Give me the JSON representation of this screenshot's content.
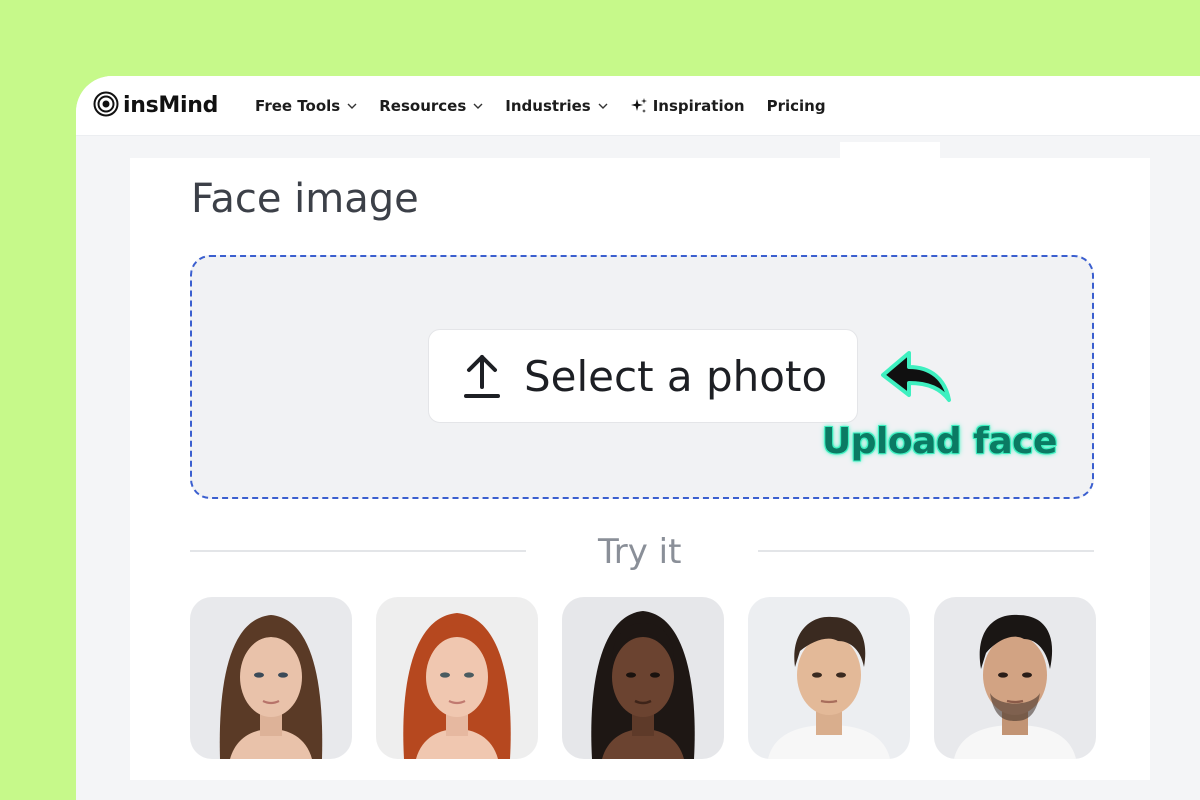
{
  "nav": {
    "logo_text": "insMind",
    "items": [
      {
        "label": "Free Tools",
        "dropdown": true
      },
      {
        "label": "Resources",
        "dropdown": true
      },
      {
        "label": "Industries",
        "dropdown": true
      },
      {
        "label": "Inspiration",
        "icon": "sparkle-icon"
      },
      {
        "label": "Pricing"
      }
    ]
  },
  "main": {
    "title": "Face image",
    "upload_button_label": "Select a photo",
    "annotation": "Upload face",
    "try_label": "Try it",
    "samples": [
      {
        "hair": "#5a3a26",
        "skin": "#e9c2aa",
        "bg": "#e8e9ec"
      },
      {
        "hair": "#b6481f",
        "skin": "#f0c7b0",
        "bg": "#eeeeee"
      },
      {
        "hair": "#1e1714",
        "skin": "#6b4330",
        "bg": "#e6e7ea"
      },
      {
        "hair": "#3a2a20",
        "skin": "#e3b998",
        "bg": "#eceef1"
      },
      {
        "hair": "#1a1614",
        "skin": "#d2a383",
        "bg": "#e8e9ec"
      }
    ]
  },
  "colors": {
    "background": "#c6f98a",
    "dropzone_border": "#3b5fcf",
    "annotation_text": "#0b7a63",
    "annotation_glow": "#3ef0c0"
  }
}
